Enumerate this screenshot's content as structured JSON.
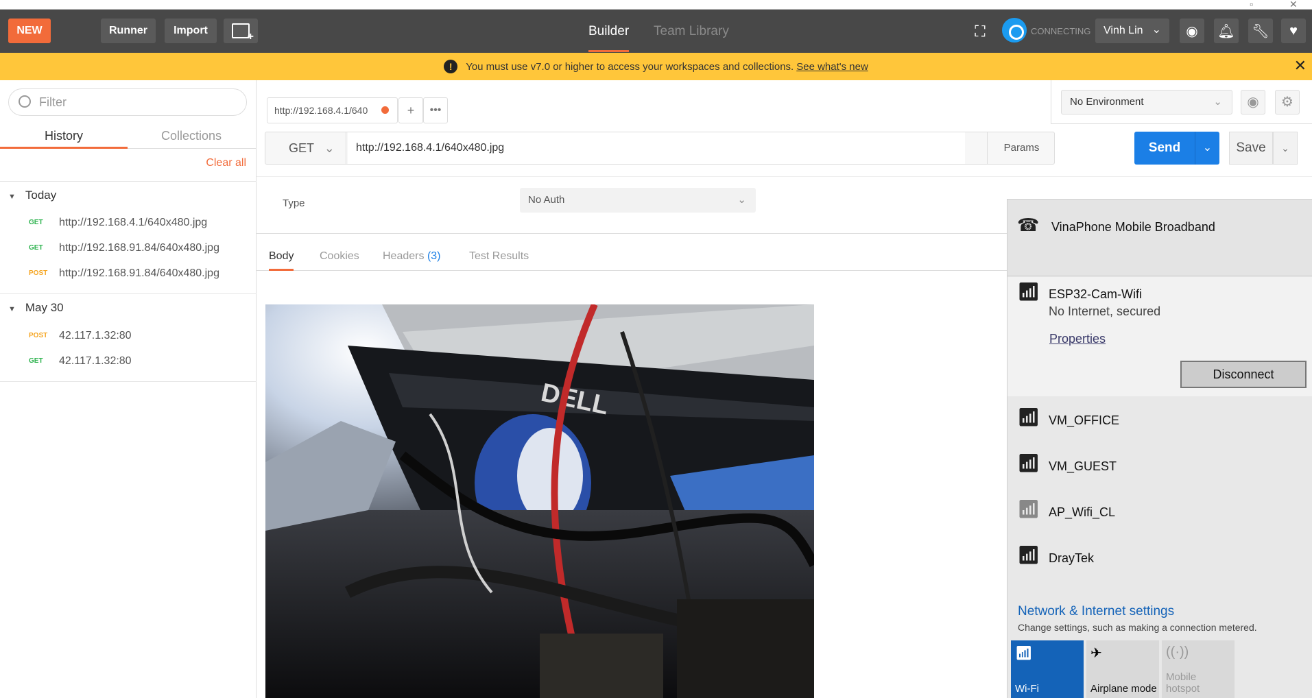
{
  "header": {
    "new_label": "NEW",
    "runner_label": "Runner",
    "import_label": "Import",
    "tabs": [
      {
        "label": "Builder"
      },
      {
        "label": "Team Library"
      }
    ],
    "sync_status": "CONNECTING",
    "user_name": "Vinh Lin",
    "accent": "#f26b3a"
  },
  "warning": {
    "message": "You must use v7.0 or higher to access your workspaces and collections.",
    "link": "See what's new",
    "bg": "#ffc63a"
  },
  "sidebar": {
    "filter_placeholder": "Filter",
    "tabs": [
      {
        "label": "History"
      },
      {
        "label": "Collections"
      }
    ],
    "clear_all": "Clear all",
    "groups": [
      {
        "title": "Today",
        "items": [
          {
            "method": "GET",
            "url": "http://192.168.4.1/640x480.jpg"
          },
          {
            "method": "GET",
            "url": "http://192.168.91.84/640x480.jpg"
          },
          {
            "method": "POST",
            "url": "http://192.168.91.84/640x480.jpg"
          }
        ]
      },
      {
        "title": "May 30",
        "items": [
          {
            "method": "POST",
            "url": "42.117.1.32:80"
          },
          {
            "method": "GET",
            "url": "42.117.1.32:80"
          }
        ]
      }
    ]
  },
  "request": {
    "tab_label": "http://192.168.4.1/640",
    "method": "GET",
    "url": "http://192.168.4.1/640x480.jpg",
    "params_label": "Params",
    "send_label": "Send",
    "save_label": "Save",
    "environment": "No Environment",
    "auth_type_label": "Type",
    "auth_value": "No Auth"
  },
  "response_tabs": {
    "body": "Body",
    "cookies": "Cookies",
    "headers": "Headers",
    "headers_count": "(3)",
    "tests": "Test Results"
  },
  "network": {
    "top_network": "VinaPhone Mobile Broadband",
    "connected": {
      "name": "ESP32-Cam-Wifi",
      "status": "No Internet, secured",
      "properties": "Properties",
      "disconnect": "Disconnect"
    },
    "networks": [
      {
        "name": "VM_OFFICE"
      },
      {
        "name": "VM_GUEST"
      },
      {
        "name": "AP_Wifi_CL"
      },
      {
        "name": "DrayTek"
      }
    ],
    "settings_title": "Network & Internet settings",
    "settings_sub": "Change settings, such as making a connection metered.",
    "tiles": [
      {
        "label": "Wi-Fi",
        "icon": "wifi-icon"
      },
      {
        "label": "Airplane mode",
        "icon": "airplane-icon"
      },
      {
        "label": "Mobile hotspot",
        "icon": "hotspot-icon"
      }
    ]
  }
}
